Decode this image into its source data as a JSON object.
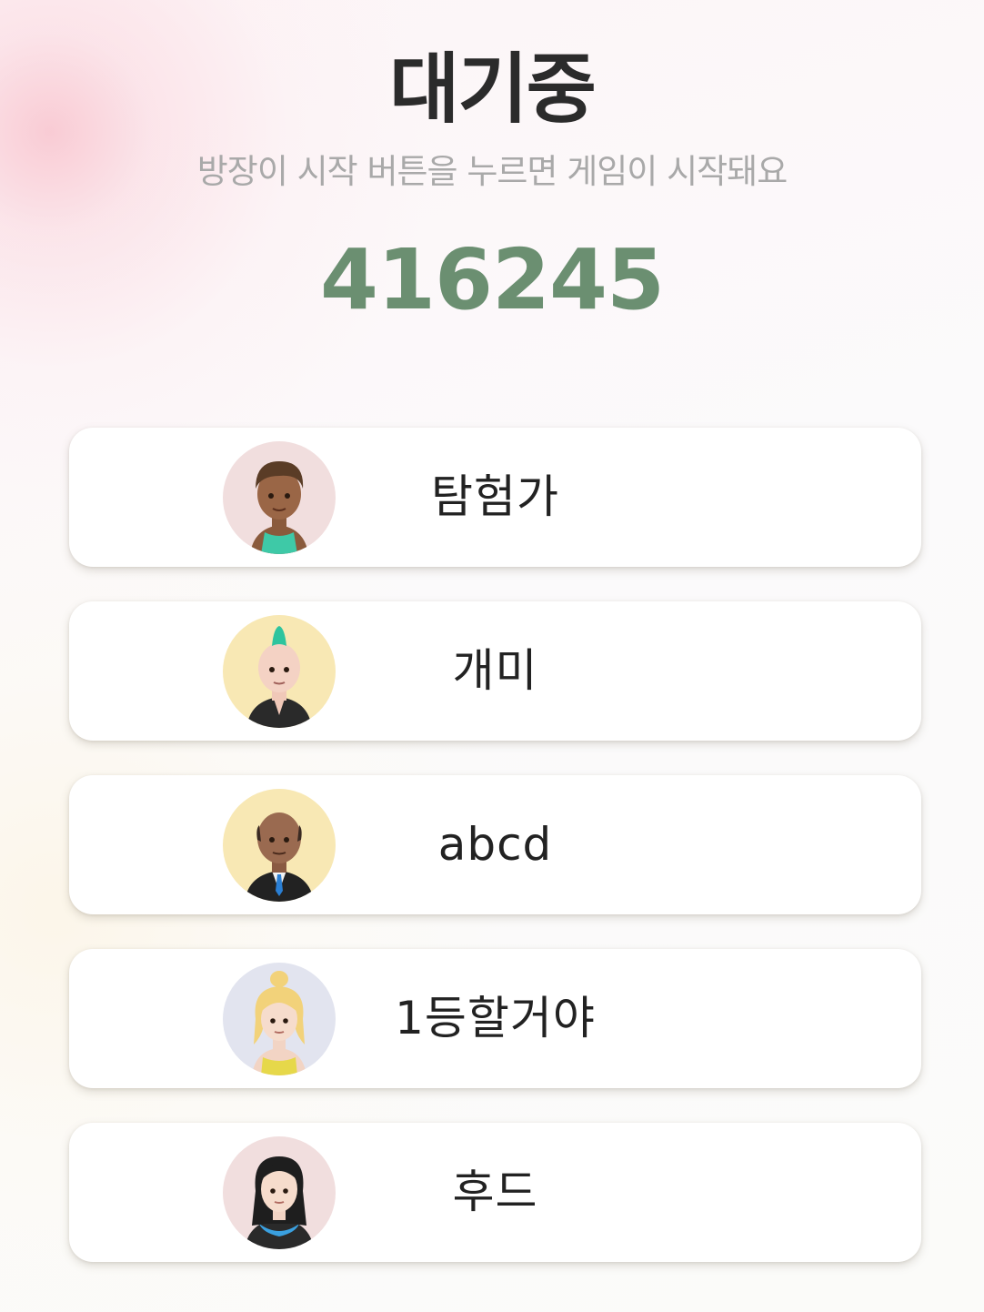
{
  "lobby": {
    "title": "대기중",
    "subtitle": "방장이 시작 버튼을 누르면 게임이 시작돼요",
    "room_code": "416245"
  },
  "players": [
    {
      "name": "탐험가",
      "avatar_icon": "avatar-boy-tank-top-icon",
      "avatar_bg": "#f1dede"
    },
    {
      "name": "개미",
      "avatar_icon": "avatar-mohawk-jacket-icon",
      "avatar_bg": "#f8e8b4"
    },
    {
      "name": "abcd",
      "avatar_icon": "avatar-bald-suit-icon",
      "avatar_bg": "#f8e8b4"
    },
    {
      "name": "1등할거야",
      "avatar_icon": "avatar-blonde-girl-icon",
      "avatar_bg": "#e2e4ef"
    },
    {
      "name": "후드",
      "avatar_icon": "avatar-long-hair-hoodie-icon",
      "avatar_bg": "#f1dede"
    }
  ],
  "colors": {
    "title": "#2b2b2b",
    "subtitle": "#a9a9a9",
    "room_code": "#6b8f71",
    "card_bg": "#ffffff"
  }
}
